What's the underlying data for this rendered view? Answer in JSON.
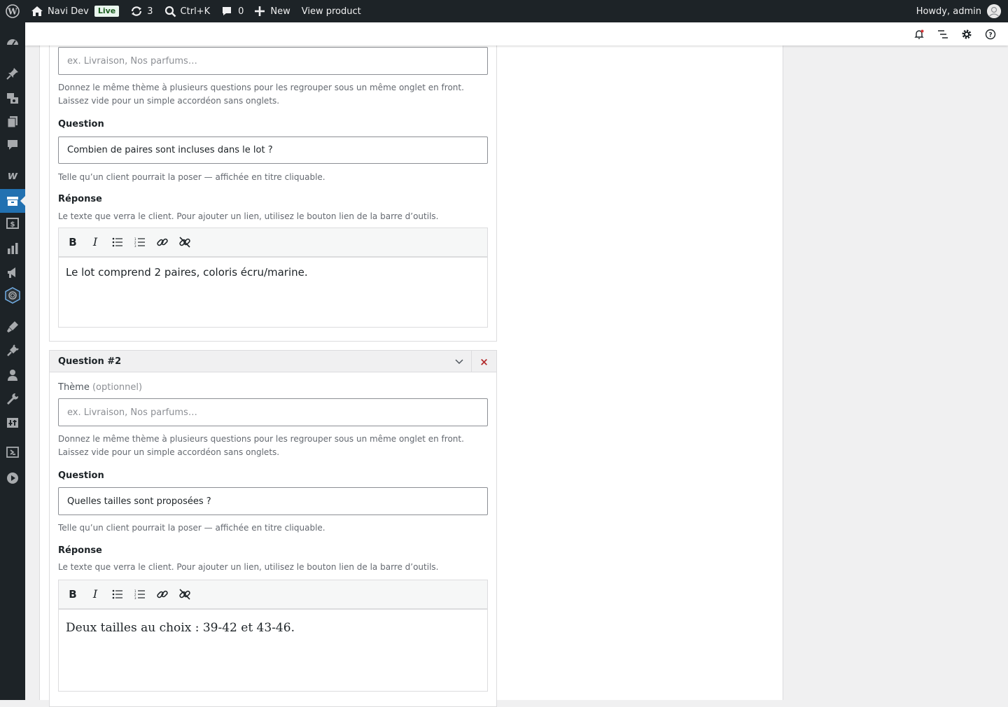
{
  "adminbar": {
    "site_name": "Navi Dev",
    "live_badge": "Live",
    "updates_count": "3",
    "search_shortcut": "Ctrl+K",
    "comments_count": "0",
    "new_label": "New",
    "view_product_label": "View product",
    "howdy": "Howdy, admin"
  },
  "sidebar": {
    "items": [
      "dashboard-icon",
      "posts-icon",
      "media-icon",
      "pages-icon",
      "comments-icon",
      "woocommerce-icon",
      "products-icon",
      "payments-icon",
      "analytics-icon",
      "marketing-icon",
      "custom-plugin-icon",
      "appearance-icon",
      "plugins-icon",
      "users-icon",
      "tools-icon",
      "settings-icon",
      "extra-plugin-icon",
      "play-icon"
    ],
    "active": "products-icon"
  },
  "toolbar": {
    "icons": [
      "notification-bell-icon",
      "outline-list-icon",
      "settings-gear-icon",
      "help-icon"
    ]
  },
  "faq1": {
    "theme_placeholder": "ex. Livraison, Nos parfums…",
    "theme_help": "Donnez le même thème à plusieurs questions pour les regrouper sous un même onglet en front. Laissez vide pour un simple accordéon sans onglets.",
    "question_label": "Question",
    "question_value": "Combien de paires sont incluses dans le lot ?",
    "question_help": "Telle qu’un client pourrait la poser — affichée en titre cliquable.",
    "answer_label": "Réponse",
    "answer_help": "Le texte que verra le client. Pour ajouter un lien, utilisez le bouton lien de la barre d’outils.",
    "answer_text": "Le lot comprend 2 paires, coloris écru/marine."
  },
  "faq2": {
    "title": "Question #2",
    "close_symbol": "×",
    "theme_label": "Thème",
    "theme_optional": "(optionnel)",
    "theme_placeholder": "ex. Livraison, Nos parfums…",
    "theme_help": "Donnez le même thème à plusieurs questions pour les regrouper sous un même onglet en front. Laissez vide pour un simple accordéon sans onglets.",
    "question_label": "Question",
    "question_value": "Quelles tailles sont proposées ?",
    "question_help": "Telle qu’un client pourrait la poser — affichée en titre cliquable.",
    "answer_label": "Réponse",
    "answer_help": "Le texte que verra le client. Pour ajouter un lien, utilisez le bouton lien de la barre d’outils.",
    "answer_text": "Deux tailles au choix : 39-42 et 43-46."
  },
  "editor_buttons": [
    "bold-icon",
    "italic-icon",
    "bullet-list-icon",
    "numbered-list-icon",
    "link-icon",
    "unlink-icon"
  ],
  "colors": {
    "adminbar_bg": "#1d2327",
    "accent": "#2271b1",
    "danger": "#b32d2e",
    "live_badge_bg": "#e9f5ee"
  }
}
